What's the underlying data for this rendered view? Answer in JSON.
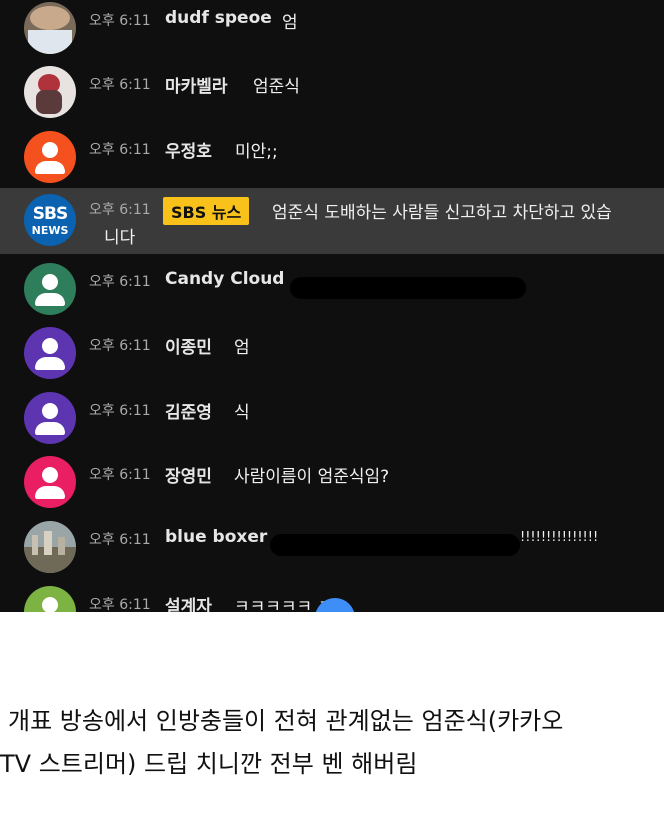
{
  "chat": {
    "messages": [
      {
        "time": "오후 6:11",
        "author": "dudf speoe",
        "text": "엄",
        "avatar_color": "#7a6a5a"
      },
      {
        "time": "오후 6:11",
        "author": "마카벨라",
        "text": "엄준식",
        "avatar_color": "#e8e2e0"
      },
      {
        "time": "오후 6:11",
        "author": "우정호",
        "text": "미안;;",
        "avatar_color": "#f4511e"
      },
      {
        "time": "오후 6:11",
        "author": "SBS 뉴스",
        "text": "엄준식 도배하는 사람들 신고하고 차단하고 있습",
        "text2": "니다",
        "logo_main": "SBS",
        "logo_sub": "NEWS",
        "badge_color": "#f9c21b"
      },
      {
        "time": "오후 6:11",
        "author": "Candy Cloud",
        "text": "",
        "avatar_color": "#2e7d5b"
      },
      {
        "time": "오후 6:11",
        "author": "이종민",
        "text": "엄",
        "avatar_color": "#5e35b1"
      },
      {
        "time": "오후 6:11",
        "author": "김준영",
        "text": "식",
        "avatar_color": "#5e35b1"
      },
      {
        "time": "오후 6:11",
        "author": "장영민",
        "text": "사람이름이 엄준식임?",
        "avatar_color": "#e91e63"
      },
      {
        "time": "오후 6:11",
        "author": "blue boxer",
        "text": "!!!!!!!!!!!!!!!",
        "avatar_color": "#8a8a80"
      },
      {
        "time": "오후 6:11",
        "author": "설계자",
        "text": "ㅋㅋㅋㅋㅋ ㅋㅋ",
        "avatar_color": "#7cb342"
      }
    ]
  },
  "caption": {
    "line1": "개표 방송에서 인방충들이 전혀 관계없는 엄준식(카카오",
    "line2": "TV 스트리머) 드립 치니깐 전부 벤 해버림"
  }
}
